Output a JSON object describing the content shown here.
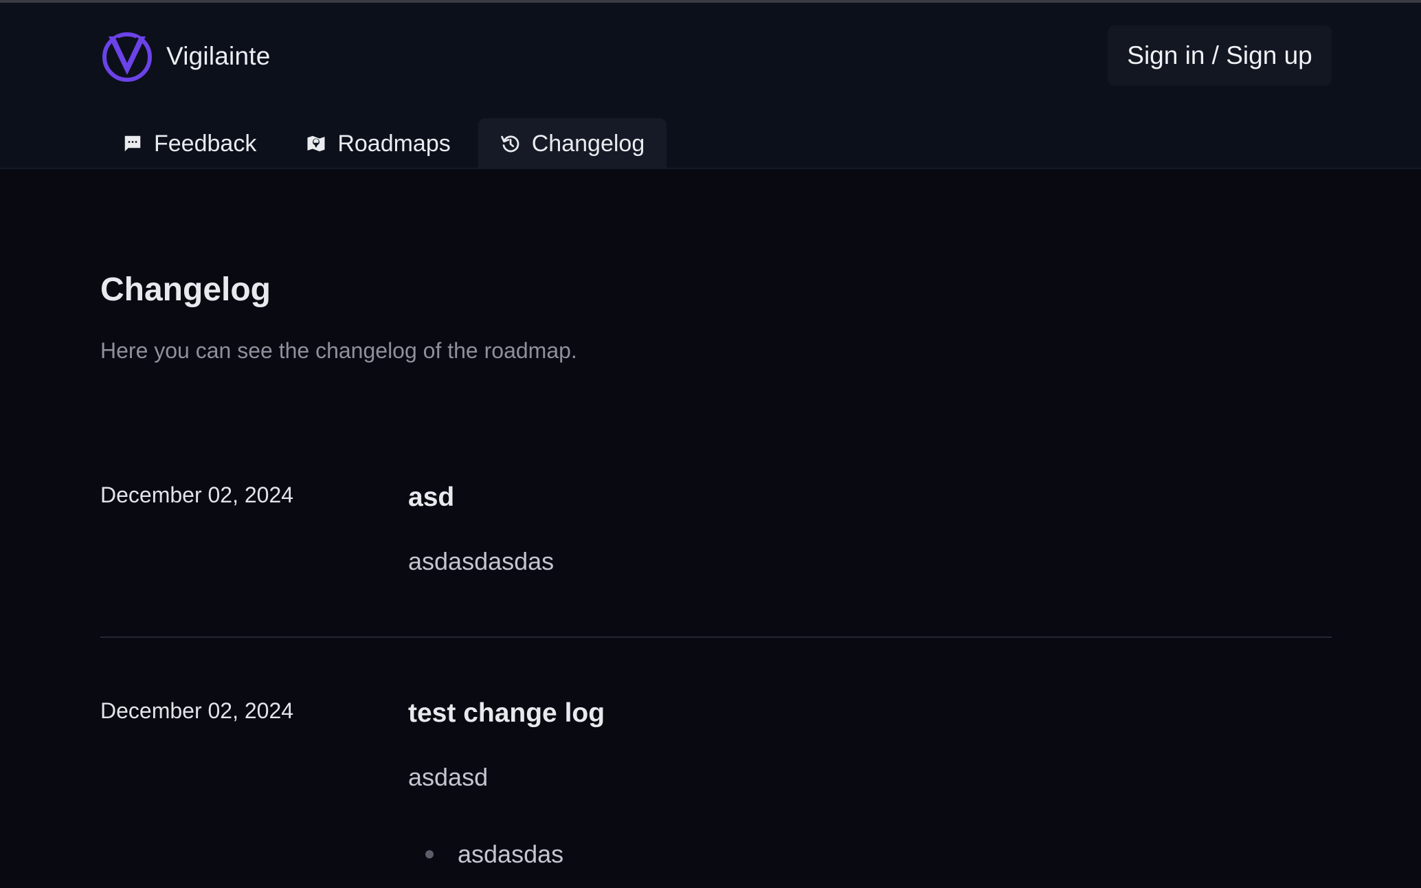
{
  "brand": {
    "name": "Vigilainte",
    "logo_icon": "v-shield-logo-icon",
    "logo_color": "#6b43e8"
  },
  "header": {
    "signin_label": "Sign in / Sign up"
  },
  "nav": {
    "tabs": [
      {
        "label": "Feedback",
        "icon": "chat-bubble-icon",
        "active": false
      },
      {
        "label": "Roadmaps",
        "icon": "map-pin-icon",
        "active": false
      },
      {
        "label": "Changelog",
        "icon": "history-clock-icon",
        "active": true
      }
    ]
  },
  "page": {
    "title": "Changelog",
    "subtitle": "Here you can see the changelog of the roadmap."
  },
  "entries": [
    {
      "date": "December 02, 2024",
      "title": "asd",
      "body": "asdasdasdas",
      "bullets": []
    },
    {
      "date": "December 02, 2024",
      "title": "test change log",
      "body": "asdasd",
      "bullets": [
        "asdasdas"
      ]
    }
  ],
  "colors": {
    "page_bg": "#080911",
    "header_bg": "#0c101b",
    "active_tab_bg": "#161a26",
    "accent": "#6b43e8"
  }
}
